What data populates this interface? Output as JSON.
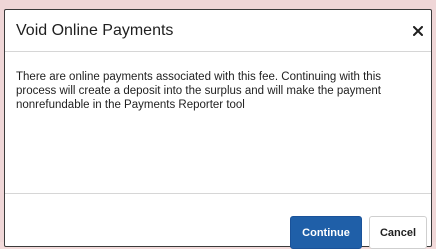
{
  "dialog": {
    "title": "Void Online Payments",
    "close_icon": "close-icon",
    "message": "There are online payments associated with this fee. Continuing with this process will create a deposit into the surplus and will make the payment nonrefundable in the Payments Reporter tool",
    "buttons": {
      "continue_label": "Continue",
      "cancel_label": "Cancel"
    }
  },
  "colors": {
    "backdrop": "#efd6d7",
    "primary_button": "#1f5fa8",
    "text": "#1f1f1f"
  }
}
